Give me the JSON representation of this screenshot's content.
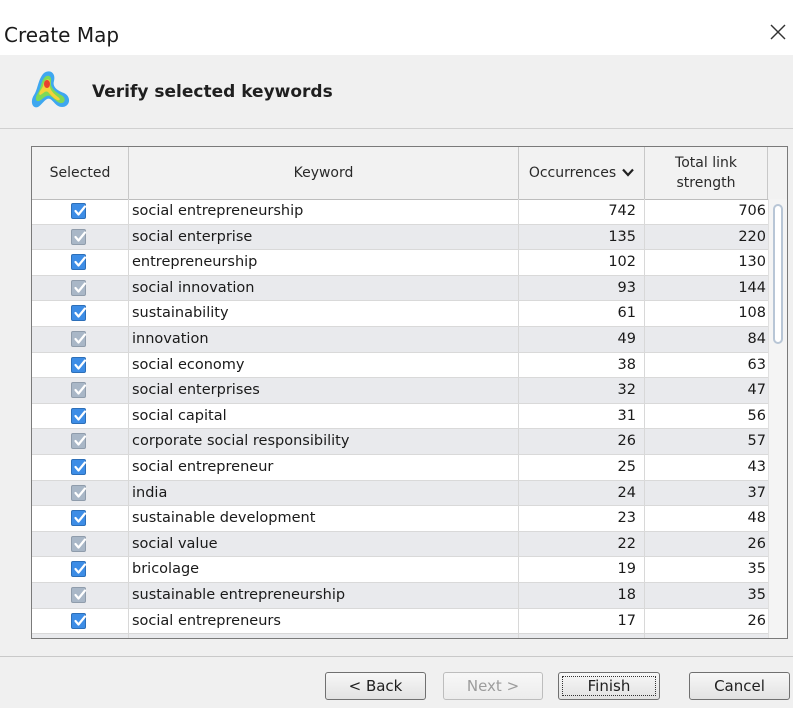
{
  "window": {
    "title": "Create Map",
    "close_icon": "close-icon"
  },
  "header": {
    "logo_icon": "vosviewer-heatmap-logo",
    "subtitle": "Verify selected keywords"
  },
  "table": {
    "columns": [
      "Selected",
      "Keyword",
      "Occurrences",
      "Total link strength"
    ],
    "sort_indicator": "chevron-down-icon",
    "rows": [
      {
        "selected": true,
        "keyword": "social entrepreneurship",
        "occurrences": "742",
        "total_link_strength": "706"
      },
      {
        "selected": true,
        "keyword": "social enterprise",
        "occurrences": "135",
        "total_link_strength": "220"
      },
      {
        "selected": true,
        "keyword": "entrepreneurship",
        "occurrences": "102",
        "total_link_strength": "130"
      },
      {
        "selected": true,
        "keyword": "social innovation",
        "occurrences": "93",
        "total_link_strength": "144"
      },
      {
        "selected": true,
        "keyword": "sustainability",
        "occurrences": "61",
        "total_link_strength": "108"
      },
      {
        "selected": true,
        "keyword": "innovation",
        "occurrences": "49",
        "total_link_strength": "84"
      },
      {
        "selected": true,
        "keyword": "social economy",
        "occurrences": "38",
        "total_link_strength": "63"
      },
      {
        "selected": true,
        "keyword": "social enterprises",
        "occurrences": "32",
        "total_link_strength": "47"
      },
      {
        "selected": true,
        "keyword": "social capital",
        "occurrences": "31",
        "total_link_strength": "56"
      },
      {
        "selected": true,
        "keyword": "corporate social responsibility",
        "occurrences": "26",
        "total_link_strength": "57"
      },
      {
        "selected": true,
        "keyword": "social entrepreneur",
        "occurrences": "25",
        "total_link_strength": "43"
      },
      {
        "selected": true,
        "keyword": "india",
        "occurrences": "24",
        "total_link_strength": "37"
      },
      {
        "selected": true,
        "keyword": "sustainable development",
        "occurrences": "23",
        "total_link_strength": "48"
      },
      {
        "selected": true,
        "keyword": "social value",
        "occurrences": "22",
        "total_link_strength": "26"
      },
      {
        "selected": true,
        "keyword": "bricolage",
        "occurrences": "19",
        "total_link_strength": "35"
      },
      {
        "selected": true,
        "keyword": "sustainable entrepreneurship",
        "occurrences": "18",
        "total_link_strength": "35"
      },
      {
        "selected": true,
        "keyword": "social entrepreneurs",
        "occurrences": "17",
        "total_link_strength": "26"
      },
      {
        "selected": true,
        "keyword": "",
        "occurrences": "",
        "total_link_strength": ""
      }
    ]
  },
  "footer": {
    "back_label": "< Back",
    "next_label": "Next >",
    "finish_label": "Finish",
    "cancel_label": "Cancel"
  },
  "colors": {
    "checkbox": "#3d8de6",
    "row_alt": "#e9eaed",
    "header_bg": "#f0f0f0"
  }
}
